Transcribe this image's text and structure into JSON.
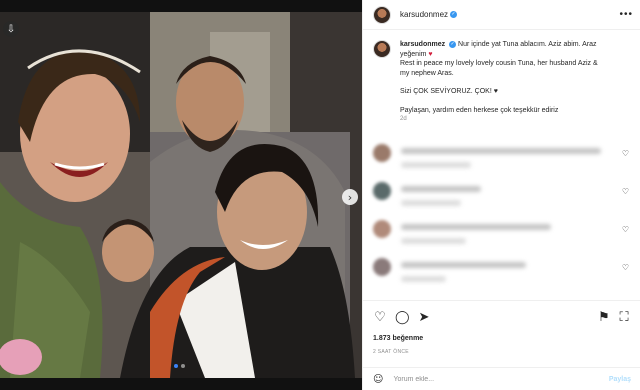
{
  "post": {
    "username": "karsudonmez",
    "verified_icon": "verified-badge-icon",
    "more_icon": "more-options-icon"
  },
  "caption": {
    "username": "karsudonmez",
    "line1": "Nur içinde yat Tuna ablacım. Aziz abim. Araz",
    "line2": "yeğenim",
    "line3": "Rest in peace my lovely lovely cousin Tuna, her husband Aziz &",
    "line4": "my nephew Aras.",
    "line5": "Sizi ÇOK SEVİYORUZ. ÇOK!",
    "line6": "Paylaşan, yardım eden herkese çok teşekkür ediriz",
    "time": "2d"
  },
  "actions": {
    "likes": "1.873 beğenme",
    "posted_ago": "2 SAAT ÖNCE",
    "comment_placeholder": "Yorum ekle...",
    "share_label": "Paylaş"
  },
  "colors": {
    "accent": "#3897f0",
    "heart": "#d21f3c"
  }
}
